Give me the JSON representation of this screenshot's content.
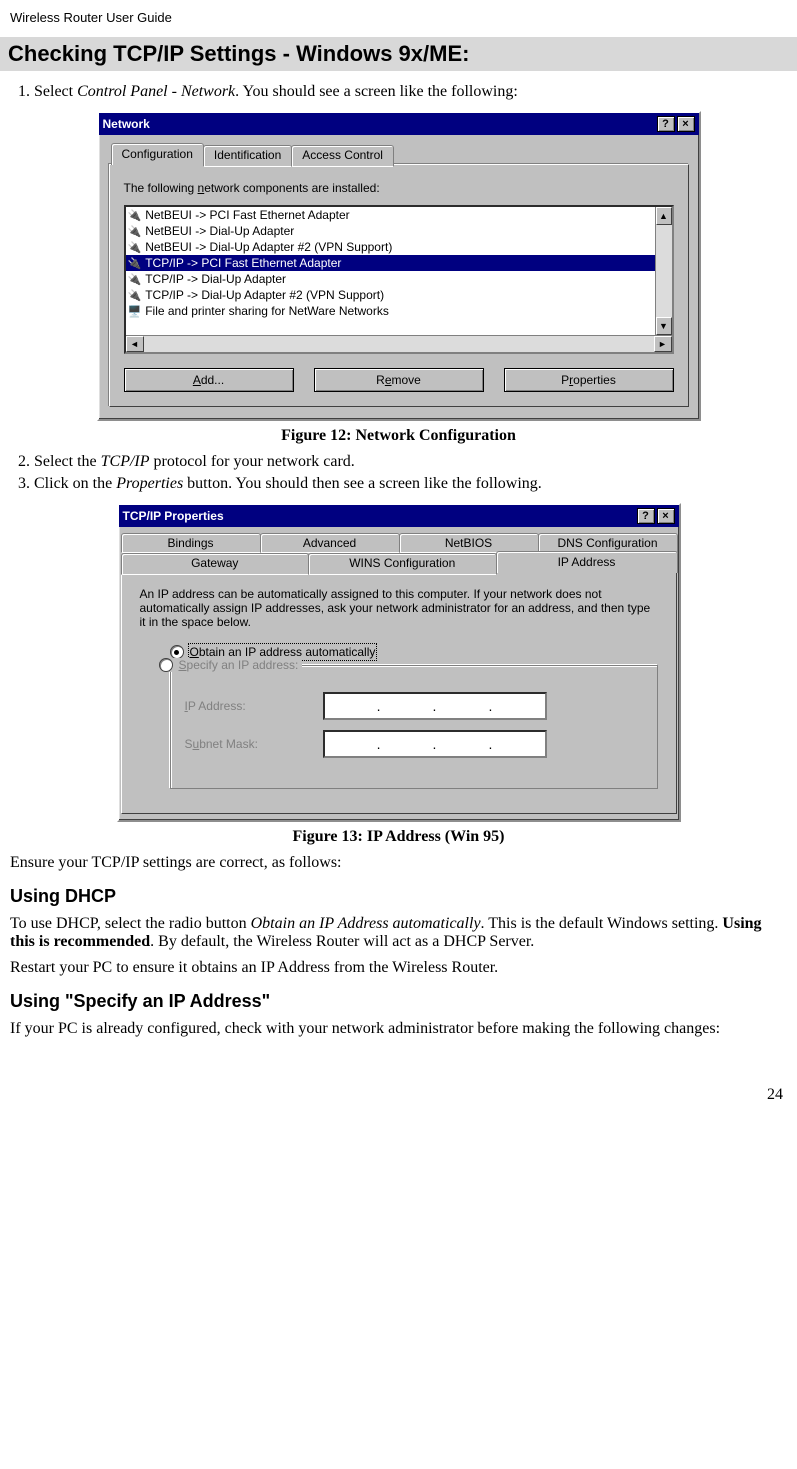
{
  "doc": {
    "header": "Wireless Router User Guide",
    "page_number": "24",
    "section_heading": "Checking TCP/IP Settings - Windows 9x/ME:",
    "step1_prefix": "Select ",
    "step1_italic": "Control Panel - Network",
    "step1_suffix": ". You should see a screen like the following:",
    "fig12_caption": "Figure 12: Network Configuration",
    "step2_prefix": "Select the ",
    "step2_italic": "TCP/IP",
    "step2_suffix": " protocol for your network card.",
    "step3_prefix": "Click on the ",
    "step3_italic": "Properties",
    "step3_suffix": " button. You should then see a screen like the following.",
    "fig13_caption": "Figure 13: IP Address (Win 95)",
    "ensure_text": "Ensure your TCP/IP settings are correct, as follows:",
    "sub_dhcp": "Using DHCP",
    "dhcp_p_prefix": "To use DHCP, select the radio button ",
    "dhcp_p_italic": "Obtain an IP Address automatically",
    "dhcp_p_mid": ". This is the default Windows setting. ",
    "dhcp_p_bold": "Using this is recommended",
    "dhcp_p_suffix": ". By default, the Wireless Router will act as a DHCP Server.",
    "dhcp_restart": "Restart your PC to ensure it obtains an IP Address from the Wireless Router.",
    "sub_specify": "Using \"Specify an IP Address\"",
    "specify_p": "If your PC is already configured, check with your network administrator before making the following changes:"
  },
  "win1": {
    "title": "Network",
    "help_btn": "?",
    "close_btn": "×",
    "tabs": {
      "configuration": "Configuration",
      "identification": "Identification",
      "access": "Access Control"
    },
    "instr_prefix": "The following ",
    "instr_underline": "n",
    "instr_suffix": "etwork components are installed:",
    "items": [
      "NetBEUI -> PCI Fast Ethernet Adapter",
      "NetBEUI -> Dial-Up Adapter",
      "NetBEUI -> Dial-Up Adapter #2 (VPN Support)",
      "TCP/IP -> PCI Fast Ethernet Adapter",
      "TCP/IP -> Dial-Up Adapter",
      "TCP/IP -> Dial-Up Adapter #2 (VPN Support)",
      "File and printer sharing for NetWare Networks"
    ],
    "btn_add_u": "A",
    "btn_add_rest": "dd...",
    "btn_remove_u": "e",
    "btn_remove_pre": "R",
    "btn_remove_post": "move",
    "btn_props_u": "r",
    "btn_props_pre": "P",
    "btn_props_post": "operties"
  },
  "win2": {
    "title": "TCP/IP Properties",
    "help_btn": "?",
    "close_btn": "×",
    "tabs_row1": {
      "bindings": "Bindings",
      "advanced": "Advanced",
      "netbios": "NetBIOS",
      "dns": "DNS Configuration"
    },
    "tabs_row2": {
      "gateway": "Gateway",
      "wins": "WINS Configuration",
      "ip": "IP Address"
    },
    "desc": "An IP address can be automatically assigned to this computer. If your network does not automatically assign IP addresses, ask your network administrator for an address, and then type it in the space below.",
    "radio_obtain_u": "O",
    "radio_obtain_rest": "btain an IP address automatically",
    "radio_specify_u": "S",
    "radio_specify_rest": "pecify an IP address:",
    "ip_label_u": "I",
    "ip_label_rest": "P Address:",
    "subnet_pre": "S",
    "subnet_u": "u",
    "subnet_post": "bnet Mask:",
    "dots": ". . ."
  }
}
